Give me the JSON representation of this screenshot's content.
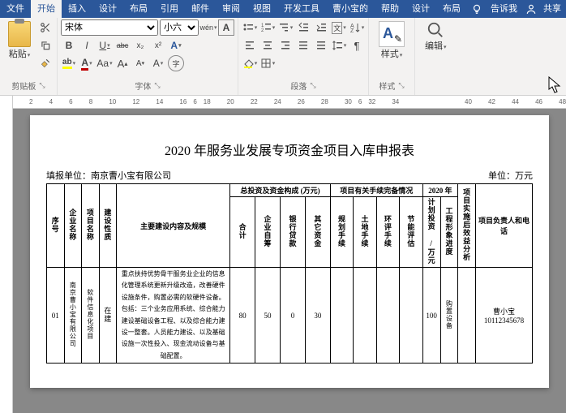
{
  "tabs": {
    "file": "文件",
    "home": "开始",
    "insert": "插入",
    "design": "设计",
    "layout": "布局",
    "references": "引用",
    "mailings": "邮件",
    "review": "审阅",
    "view": "视图",
    "devtools": "开发工具",
    "caoxiaobao": "曹小宝的",
    "help": "帮助",
    "design2": "设计",
    "layout2": "布局",
    "tellme": "告诉我",
    "share": "共享"
  },
  "ribbon": {
    "clipboard": {
      "paste": "粘贴",
      "label": "剪贴板"
    },
    "font": {
      "name": "宋体",
      "size": "小六",
      "label": "字体",
      "bold": "B",
      "italic": "I",
      "underline": "U",
      "strike": "abc",
      "sub": "x₂",
      "sup": "x²",
      "highlight_color": "#ffff00",
      "font_color": "#c00000"
    },
    "paragraph": {
      "label": "段落"
    },
    "styles": {
      "button": "样式",
      "label": "样式"
    },
    "editing": {
      "button": "编辑"
    }
  },
  "ruler_marks": [
    "2",
    "",
    "4",
    "",
    "6",
    "",
    "8",
    "",
    "10",
    "",
    "12",
    "",
    "14",
    "",
    "16",
    "6",
    "18",
    "",
    "20",
    "",
    "22",
    "",
    "24",
    "",
    "26",
    "",
    "28",
    "",
    "30",
    "6",
    "32",
    "",
    "34",
    "",
    "",
    "",
    "",
    "",
    "",
    "40",
    "",
    "42",
    "",
    "44",
    "",
    "46",
    "",
    "48"
  ],
  "doc": {
    "title": "2020 年服务业发展专项资金项目入库申报表",
    "org_label": "填报单位：",
    "org_value": "南京曹小宝有限公司",
    "unit": "单位：万元",
    "headers": {
      "seq": "序号",
      "ent": "企业名称",
      "proj": "项目名称",
      "nature": "建设性质",
      "content": "主要建设内容及规模",
      "invest_group": "总投资及资金构成 (万元)",
      "total": "合计",
      "self": "企业自筹",
      "bank": "银行贷款",
      "other": "其它资金",
      "approval_group": "项目有关手续完备情况",
      "plan": "规划手续",
      "land": "土地手续",
      "env": "环评手续",
      "energy": "节能评估",
      "year_group": "2020 年",
      "plan_invest": "计划投资 /万元",
      "image": "工程形象进度",
      "benefit": "项目实施后效益分析",
      "contact": "项目负责人和电话"
    },
    "row": {
      "seq": "01",
      "ent": "南京曹小宝有限公司",
      "proj": "软件信息化项目",
      "nature": "在建",
      "content": "重点扶持优势骨干服务业企业的信息化管理系统更新升级改造，改善硬件设施条件，购置必需的软硬件设备。包括：三个业务应用系统、综合能力建设基础设备工程、以及综合能力建设一整套。人员能力建设、以及基础设施一次性投入、现金流动设备与基础配置。",
      "total": "80",
      "self": "50",
      "bank": "0",
      "other": "30",
      "plan": "",
      "land": "",
      "env": "",
      "energy": "",
      "plan_invest": "100",
      "image": "购置设备",
      "benefit": "",
      "contact_name": "曹小宝",
      "contact_phone": "10112345678"
    }
  }
}
